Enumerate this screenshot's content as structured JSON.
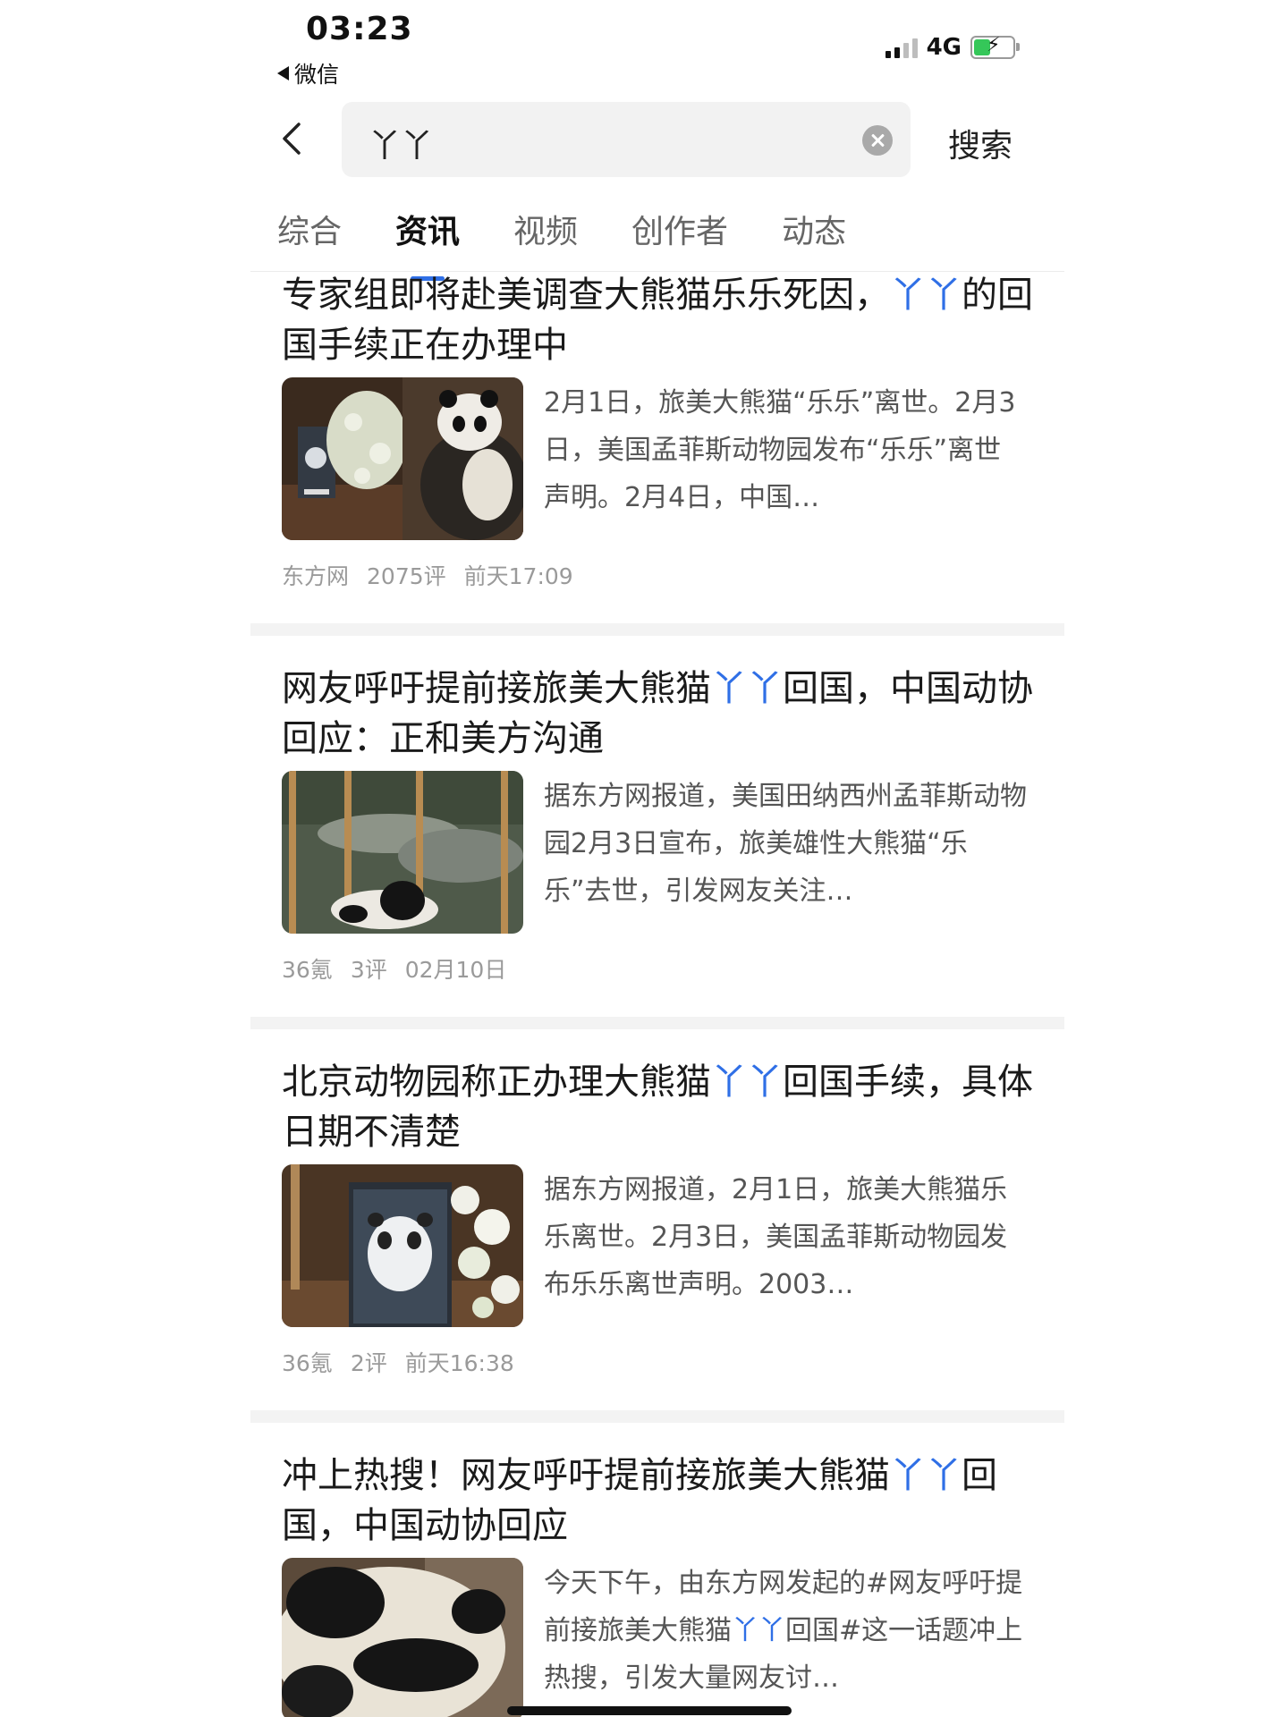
{
  "status": {
    "time": "03:23",
    "back_app": "微信",
    "network": "4G"
  },
  "search": {
    "query": "丫丫",
    "submit_label": "搜索"
  },
  "tabs": [
    {
      "label": "综合"
    },
    {
      "label": "资讯"
    },
    {
      "label": "视频"
    },
    {
      "label": "创作者"
    },
    {
      "label": "动态"
    }
  ],
  "active_tab": "资讯",
  "highlight_color": "#2f6fe6",
  "articles": [
    {
      "title_parts": [
        {
          "t": "专家组即将赴美调查大熊猫乐乐死因，"
        },
        {
          "t": "丫丫",
          "hl": true
        },
        {
          "t": "的回国手续正在办理中"
        }
      ],
      "summary_parts": [
        {
          "t": "2月1日，旅美大熊猫“乐乐”离世。2月3日，美国孟菲斯动物园发布“乐乐”离世声明。2月4日，中国…"
        }
      ],
      "source": "东方网",
      "comments": "2075评",
      "time": "前天17:09"
    },
    {
      "title_parts": [
        {
          "t": "网友呼吁提前接旅美大熊猫"
        },
        {
          "t": "丫丫",
          "hl": true
        },
        {
          "t": "回国，中国动协回应：正和美方沟通"
        }
      ],
      "summary_parts": [
        {
          "t": "据东方网报道，美国田纳西州孟菲斯动物园2月3日宣布，旅美雄性大熊猫“乐乐”去世，引发网友关注…"
        }
      ],
      "source": "36氪",
      "comments": "3评",
      "time": "02月10日"
    },
    {
      "title_parts": [
        {
          "t": "北京动物园称正办理大熊猫"
        },
        {
          "t": "丫丫",
          "hl": true
        },
        {
          "t": "回国手续，具体日期不清楚"
        }
      ],
      "summary_parts": [
        {
          "t": "据东方网报道，2月1日，旅美大熊猫乐乐离世。2月3日，美国孟菲斯动物园发布乐乐离世声明。2003…"
        }
      ],
      "source": "36氪",
      "comments": "2评",
      "time": "前天16:38"
    },
    {
      "title_parts": [
        {
          "t": "冲上热搜！网友呼吁提前接旅美大熊猫"
        },
        {
          "t": "丫丫",
          "hl": true
        },
        {
          "t": "回国，中国动协回应"
        }
      ],
      "summary_parts": [
        {
          "t": "今天下午，由东方网发起的#网友呼吁提前接旅美大熊猫"
        },
        {
          "t": "丫丫",
          "hl": true
        },
        {
          "t": "回国#这一话题冲上热搜，引发大量网友讨…"
        }
      ],
      "source": "",
      "comments": "",
      "time": ""
    }
  ]
}
